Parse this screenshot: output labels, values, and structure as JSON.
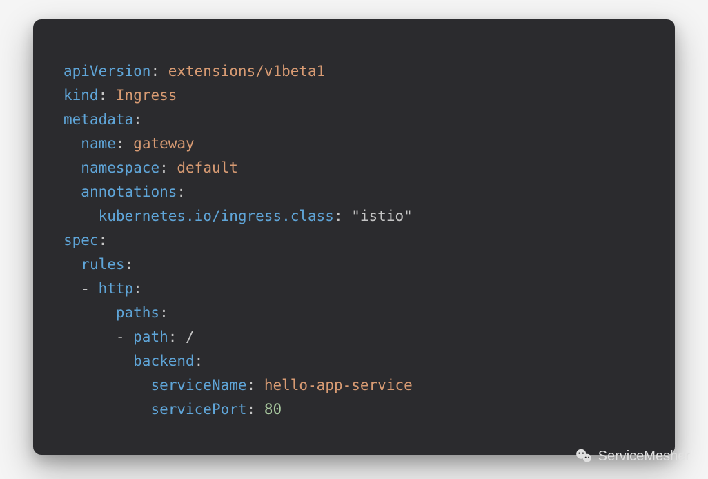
{
  "code": {
    "lines": [
      {
        "indent": 0,
        "tokens": [
          {
            "t": "key",
            "v": "apiVersion"
          },
          {
            "t": "colon",
            "v": ": "
          },
          {
            "t": "value-orange",
            "v": "extensions/v1beta1"
          }
        ]
      },
      {
        "indent": 0,
        "tokens": [
          {
            "t": "key",
            "v": "kind"
          },
          {
            "t": "colon",
            "v": ": "
          },
          {
            "t": "value-orange",
            "v": "Ingress"
          }
        ]
      },
      {
        "indent": 0,
        "tokens": [
          {
            "t": "key",
            "v": "metadata"
          },
          {
            "t": "colon",
            "v": ":"
          }
        ]
      },
      {
        "indent": 1,
        "tokens": [
          {
            "t": "key",
            "v": "name"
          },
          {
            "t": "colon",
            "v": ": "
          },
          {
            "t": "value-orange",
            "v": "gateway"
          }
        ]
      },
      {
        "indent": 1,
        "tokens": [
          {
            "t": "key",
            "v": "namespace"
          },
          {
            "t": "colon",
            "v": ": "
          },
          {
            "t": "value-orange",
            "v": "default"
          }
        ]
      },
      {
        "indent": 1,
        "tokens": [
          {
            "t": "key",
            "v": "annotations"
          },
          {
            "t": "colon",
            "v": ":"
          }
        ]
      },
      {
        "indent": 2,
        "tokens": [
          {
            "t": "key",
            "v": "kubernetes.io/ingress.class"
          },
          {
            "t": "colon",
            "v": ": "
          },
          {
            "t": "value-string",
            "v": "\"istio\""
          }
        ]
      },
      {
        "indent": 0,
        "tokens": [
          {
            "t": "key",
            "v": "spec"
          },
          {
            "t": "colon",
            "v": ":"
          }
        ]
      },
      {
        "indent": 1,
        "tokens": [
          {
            "t": "key",
            "v": "rules"
          },
          {
            "t": "colon",
            "v": ":"
          }
        ]
      },
      {
        "indent": 1,
        "tokens": [
          {
            "t": "dash",
            "v": "- "
          },
          {
            "t": "key",
            "v": "http"
          },
          {
            "t": "colon",
            "v": ":"
          }
        ]
      },
      {
        "indent": 3,
        "tokens": [
          {
            "t": "key",
            "v": "paths"
          },
          {
            "t": "colon",
            "v": ":"
          }
        ]
      },
      {
        "indent": 3,
        "tokens": [
          {
            "t": "dash",
            "v": "- "
          },
          {
            "t": "key",
            "v": "path"
          },
          {
            "t": "colon",
            "v": ": "
          },
          {
            "t": "slash",
            "v": "/"
          }
        ]
      },
      {
        "indent": 4,
        "tokens": [
          {
            "t": "key",
            "v": "backend"
          },
          {
            "t": "colon",
            "v": ":"
          }
        ]
      },
      {
        "indent": 5,
        "tokens": [
          {
            "t": "key",
            "v": "serviceName"
          },
          {
            "t": "colon",
            "v": ": "
          },
          {
            "t": "value-orange",
            "v": "hello-app-service"
          }
        ]
      },
      {
        "indent": 5,
        "tokens": [
          {
            "t": "key",
            "v": "servicePort"
          },
          {
            "t": "colon",
            "v": ": "
          },
          {
            "t": "value-number",
            "v": "80"
          }
        ]
      }
    ]
  },
  "watermark": {
    "text": "ServiceMesher"
  }
}
